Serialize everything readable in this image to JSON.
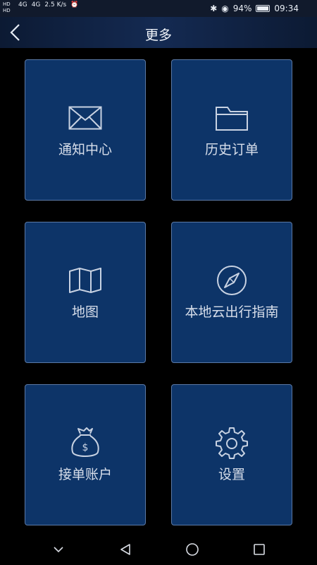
{
  "status_bar": {
    "hd_top": "HD",
    "hd_bottom": "HD",
    "signal_1": "4G",
    "signal_2": "4G",
    "speed": "2.5 K/s",
    "battery": "94%",
    "time": "09:34"
  },
  "nav": {
    "title": "更多"
  },
  "menu": [
    {
      "label": "通知中心",
      "icon": "mail-icon"
    },
    {
      "label": "历史订单",
      "icon": "folder-icon"
    },
    {
      "label": "地图",
      "icon": "map-icon"
    },
    {
      "label": "本地云出行指南",
      "icon": "compass-icon"
    },
    {
      "label": "接单账户",
      "icon": "money-bag-icon"
    },
    {
      "label": "设置",
      "icon": "gear-icon"
    }
  ],
  "colors": {
    "card_bg": "#0d3468",
    "card_border": "#5b79a6",
    "icon_stroke": "#c8d2e2"
  }
}
